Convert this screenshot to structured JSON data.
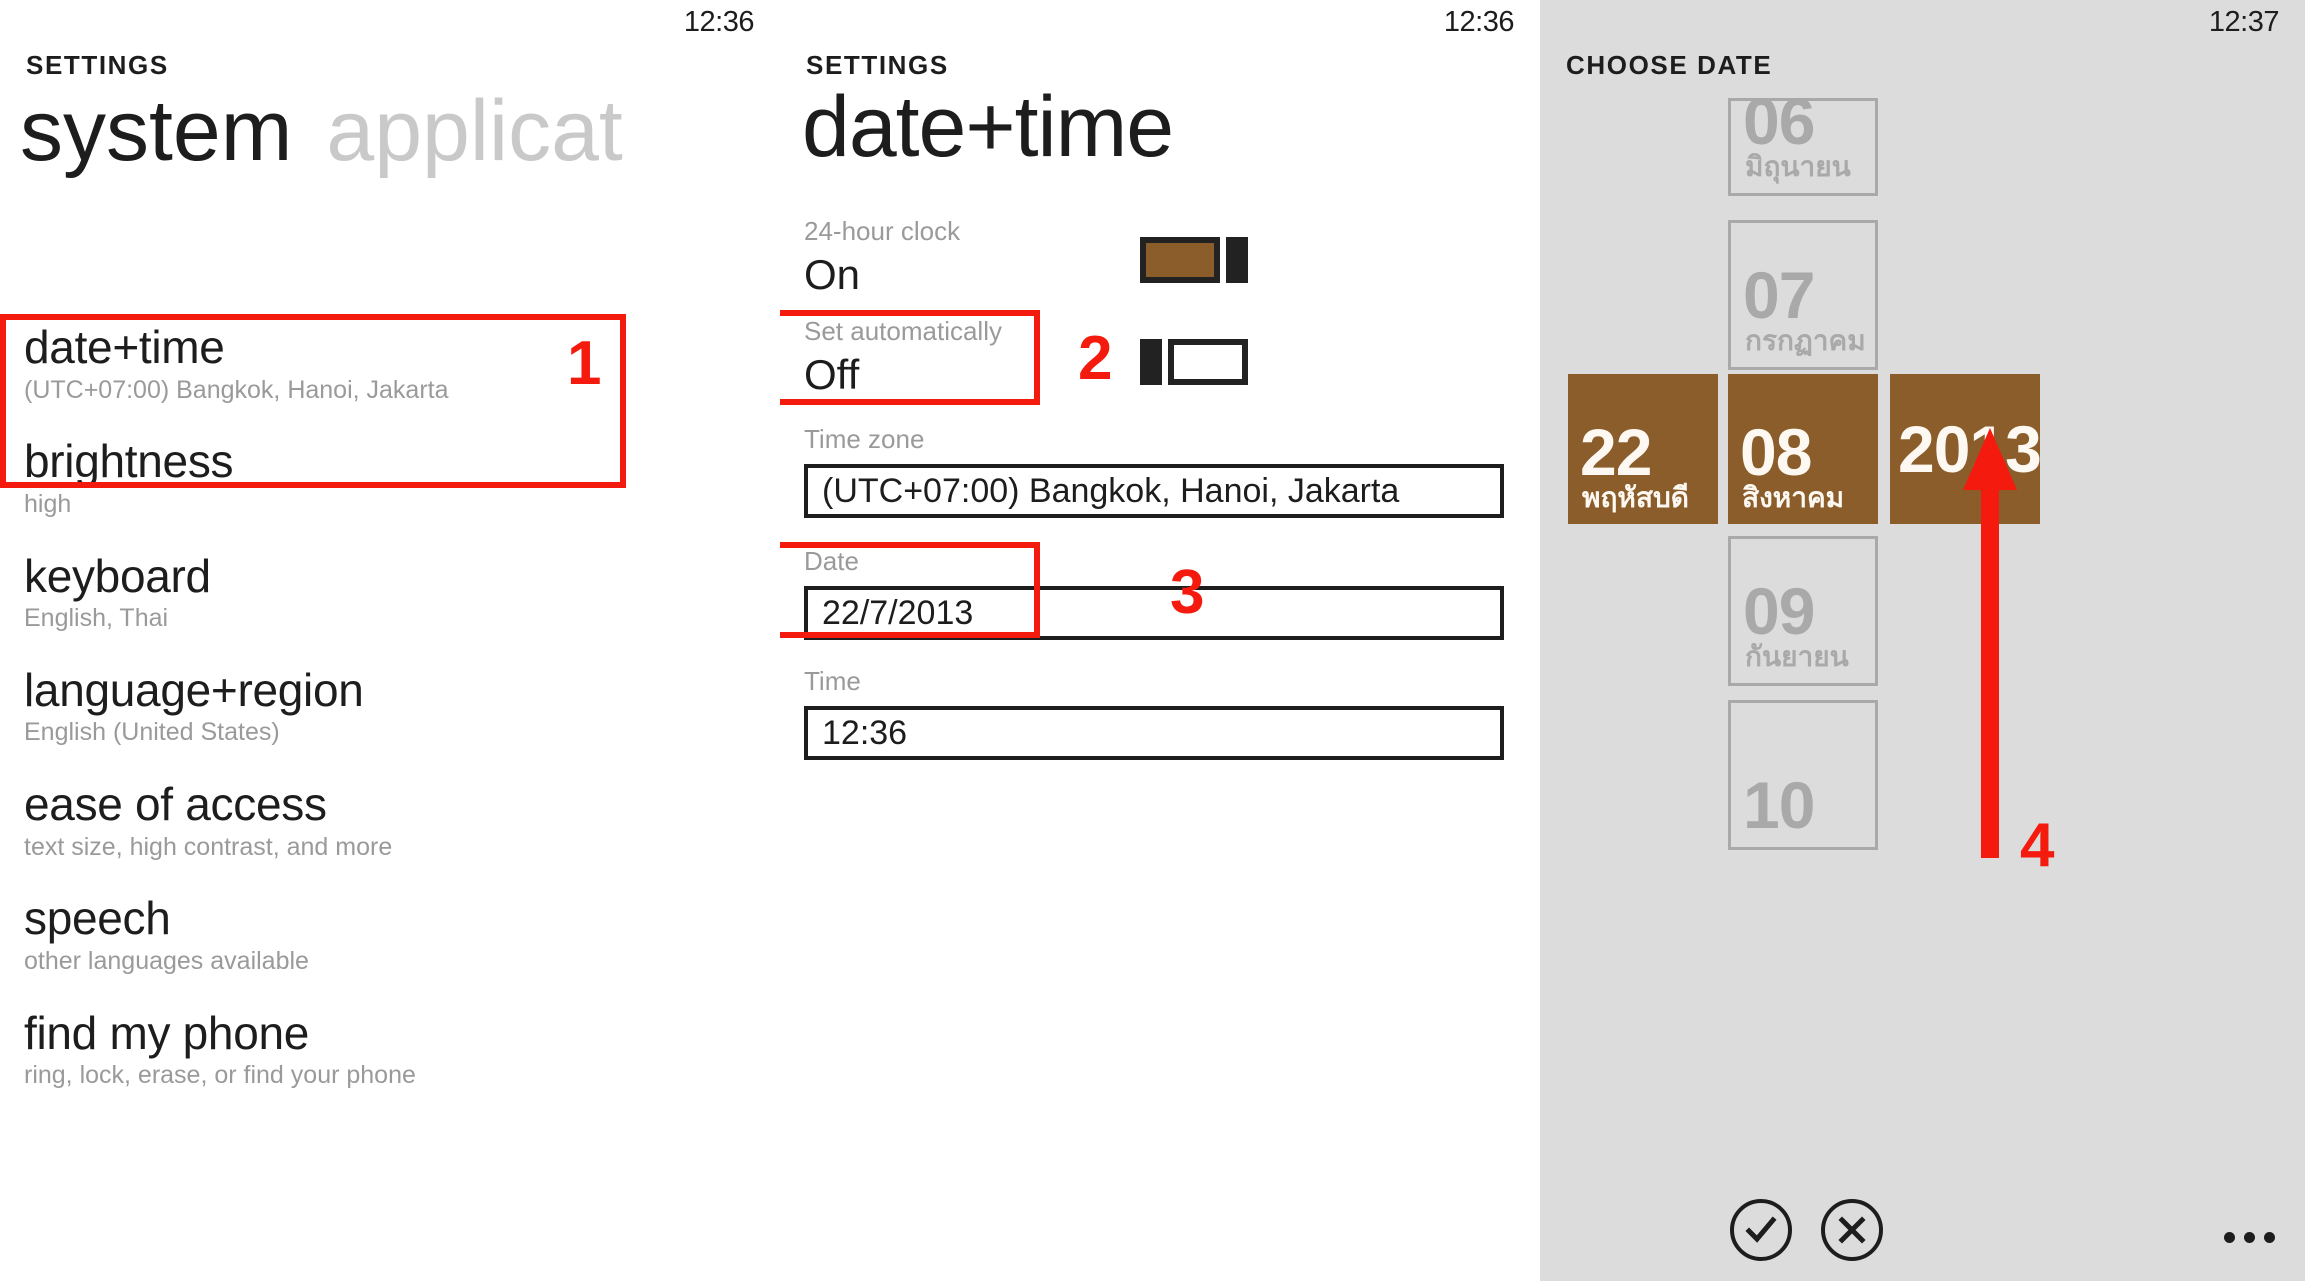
{
  "theme": {
    "accent_brown": "#8a5d2a",
    "annotation_red": "#f41b0e",
    "panel_c_bg": "#dcdcdc",
    "text_dark": "#1d1d1d",
    "text_muted": "#9a9a9a"
  },
  "panel_settings_system": {
    "status_time": "12:36",
    "app_title": "SETTINGS",
    "pivot_active": "system",
    "pivot_inactive": "applicat",
    "items": [
      {
        "title": "date+time",
        "subtitle": "(UTC+07:00) Bangkok, Hanoi, Jakarta"
      },
      {
        "title": "brightness",
        "subtitle": "high"
      },
      {
        "title": "keyboard",
        "subtitle": "English, Thai"
      },
      {
        "title": "language+region",
        "subtitle": "English (United States)"
      },
      {
        "title": "ease of access",
        "subtitle": "text size, high contrast, and more"
      },
      {
        "title": "speech",
        "subtitle": "other languages available"
      },
      {
        "title": "find my phone",
        "subtitle": "ring, lock, erase, or find your phone"
      }
    ]
  },
  "panel_date_time": {
    "status_time": "12:36",
    "app_title": "SETTINGS",
    "page_title": "date+time",
    "clock24": {
      "label": "24-hour clock",
      "value": "On",
      "state": "on"
    },
    "set_automatically": {
      "label": "Set automatically",
      "value": "Off",
      "state": "off"
    },
    "time_zone": {
      "label": "Time zone",
      "value": "(UTC+07:00) Bangkok, Hanoi, Jakarta"
    },
    "date": {
      "label": "Date",
      "value": "22/7/2013"
    },
    "time": {
      "label": "Time",
      "value": "12:36"
    }
  },
  "panel_choose_date": {
    "status_time": "12:37",
    "app_title": "CHOOSE DATE",
    "columns": {
      "day": {
        "above": [],
        "selected": {
          "num": "22",
          "sub": "พฤหัสบดี"
        },
        "below": []
      },
      "month": {
        "above": [
          {
            "num": "06",
            "sub": "มิถุนายน"
          },
          {
            "num": "07",
            "sub": "กรกฏาคม"
          }
        ],
        "selected": {
          "num": "08",
          "sub": "สิงหาคม"
        },
        "below": [
          {
            "num": "09",
            "sub": "กันยายน"
          },
          {
            "num": "10",
            "sub": ""
          }
        ]
      },
      "year": {
        "above": [],
        "selected": {
          "num": "2013",
          "sub": ""
        },
        "below": []
      }
    },
    "appbar": {
      "done_icon": "check-icon",
      "cancel_icon": "close-icon",
      "more_icon": "ellipsis-icon"
    }
  },
  "annotations": {
    "step1": "1",
    "step2": "2",
    "step3": "3",
    "step4": "4"
  }
}
